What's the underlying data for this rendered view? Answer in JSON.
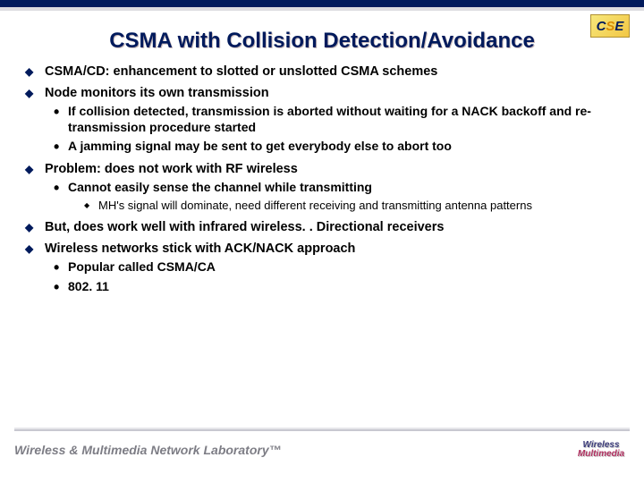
{
  "logo_top": {
    "c": "C",
    "s": "S",
    "e": "E"
  },
  "title": "CSMA with Collision Detection/Avoidance",
  "bullets": [
    {
      "text": "CSMA/CD: enhancement to slotted or unslotted CSMA schemes"
    },
    {
      "text": "Node monitors its own transmission",
      "sub": [
        {
          "text": "If collision detected, transmission is aborted without waiting for a NACK backoff and re-transmission procedure started"
        },
        {
          "text": "A jamming signal may be sent to get everybody else to abort too"
        }
      ]
    },
    {
      "text": "Problem: does not work with RF wireless",
      "sub": [
        {
          "text": "Cannot easily sense the channel while transmitting",
          "sub": [
            {
              "text": "MH's signal will dominate, need different receiving and transmitting antenna patterns"
            }
          ]
        }
      ]
    },
    {
      "text": "But, does work well with infrared wireless. . Directional receivers"
    },
    {
      "text": "Wireless networks stick with ACK/NACK approach",
      "sub": [
        {
          "text": "Popular called CSMA/CA"
        },
        {
          "text": "802. 11"
        }
      ]
    }
  ],
  "footer": "Wireless & Multimedia Network Laboratory™",
  "logo_bottom": {
    "row1": "Wireless",
    "row2": "Multimedia"
  }
}
